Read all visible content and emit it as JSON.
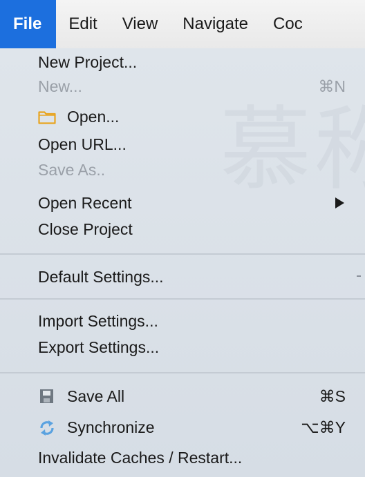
{
  "menubar": {
    "items": [
      {
        "label": "File",
        "active": true
      },
      {
        "label": "Edit"
      },
      {
        "label": "View"
      },
      {
        "label": "Navigate"
      },
      {
        "label": "Coc"
      }
    ]
  },
  "watermark": "慕称",
  "file_menu": {
    "new_project": "New Project...",
    "new": {
      "label": "New...",
      "shortcut": "⌘N"
    },
    "open": {
      "label": "Open...",
      "icon": "folder-icon"
    },
    "open_url": "Open URL...",
    "save_as": "Save As..",
    "open_recent": "Open Recent",
    "close_project": "Close Project",
    "default_settings": "Default Settings...",
    "import_settings": "Import Settings...",
    "export_settings": "Export Settings...",
    "save_all": {
      "label": "Save All",
      "shortcut": "⌘S",
      "icon": "save-icon"
    },
    "synchronize": {
      "label": "Synchronize",
      "shortcut": "⌥⌘Y",
      "icon": "sync-icon"
    },
    "invalidate_caches": "Invalidate Caches / Restart..."
  },
  "colors": {
    "accent": "#1c6fde",
    "folder": "#e8a41f",
    "sync": "#5aa2e0",
    "disabled": "#9aa0a8"
  }
}
